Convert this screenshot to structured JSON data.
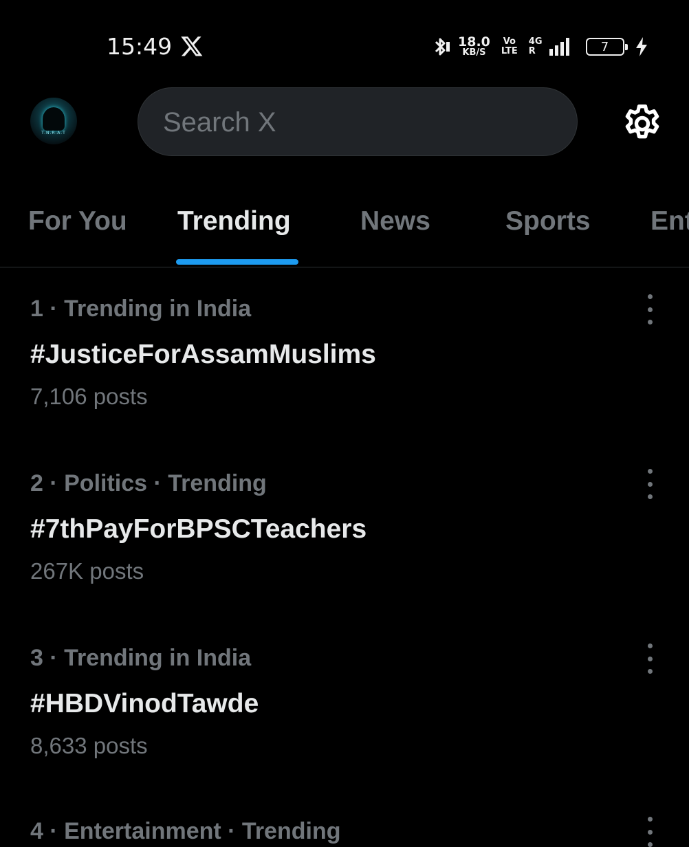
{
  "status_bar": {
    "time": "15:49",
    "network_speed_value": "18.0",
    "network_speed_unit": "KB/S",
    "volte_top": "Vo",
    "volte_bottom": "LTE",
    "network_type": "4G",
    "roaming": "R",
    "battery_level": "7",
    "icons": [
      "x-logo-icon",
      "bluetooth-icon",
      "signal-icon",
      "battery-icon",
      "charging-icon"
    ]
  },
  "header": {
    "search_placeholder": "Search X",
    "avatar_text": "T.N.R.A.T",
    "icons": [
      "avatar",
      "gear-icon"
    ]
  },
  "tabs": [
    {
      "label": "For You",
      "active": false
    },
    {
      "label": "Trending",
      "active": true
    },
    {
      "label": "News",
      "active": false
    },
    {
      "label": "Sports",
      "active": false
    },
    {
      "label": "Entertainment",
      "active": false
    }
  ],
  "trends": [
    {
      "meta": "1 · Trending in India",
      "title": "#JusticeForAssamMuslims",
      "count": "7,106 posts"
    },
    {
      "meta": "2 · Politics · Trending",
      "title": "#7thPayForBPSCTeachers",
      "count": "267K posts"
    },
    {
      "meta": "3 · Trending in India",
      "title": "#HBDVinodTawde",
      "count": "8,633 posts"
    },
    {
      "meta": "4 · Entertainment · Trending",
      "title": "",
      "count": ""
    }
  ],
  "colors": {
    "background": "#000000",
    "text_primary": "#e7e9ea",
    "text_secondary": "#71767b",
    "accent": "#1d9bf0",
    "search_bg": "#202327"
  }
}
